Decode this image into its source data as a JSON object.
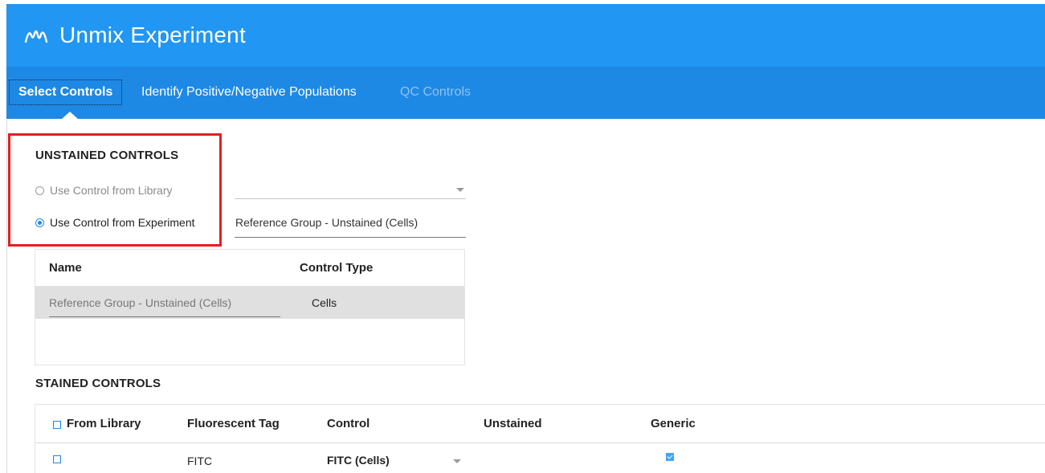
{
  "app": {
    "title": "Unmix Experiment",
    "logo_icon": "wave-logo-icon",
    "header_color": "#2196f3",
    "tabbar_color": "#1e88e5"
  },
  "tabs": [
    {
      "label": "Select Controls",
      "state": "active"
    },
    {
      "label": "Identify Positive/Negative Populations",
      "state": "enabled"
    },
    {
      "label": "QC Controls",
      "state": "disabled"
    }
  ],
  "unstained": {
    "title": "UNSTAINED CONTROLS",
    "option_library": "Use Control from Library",
    "option_experiment": "Use Control from Experiment",
    "selected_option": "experiment",
    "library_select_value": "",
    "experiment_select_value": "Reference Group - Unstained (Cells)",
    "table": {
      "headers": [
        "Name",
        "Control Type"
      ],
      "rows": [
        {
          "name": "Reference Group - Unstained (Cells)",
          "type": "Cells",
          "selected": true
        }
      ]
    }
  },
  "stained": {
    "title": "STAINED CONTROLS",
    "headers": {
      "from_library": "From Library",
      "fluorescent_tag": "Fluorescent Tag",
      "control": "Control",
      "unstained": "Unstained",
      "generic": "Generic"
    },
    "rows": [
      {
        "from_library": false,
        "fluorescent_tag": "FITC",
        "control": "FITC (Cells)",
        "unstained": "",
        "generic": true
      }
    ]
  },
  "highlight_color": "#e02020"
}
